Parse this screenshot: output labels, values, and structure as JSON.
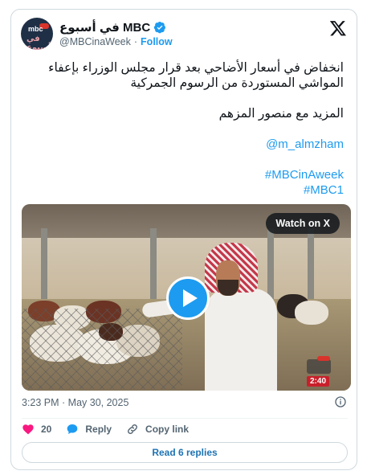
{
  "account": {
    "display_name": "في أسبوع MBC",
    "handle": "@MBCinaWeek",
    "separator": "·",
    "follow_label": "Follow",
    "avatar_logo_top": "mbc",
    "avatar_logo_bottom": "في أسبوع"
  },
  "tweet": {
    "lines": [
      "انخفاض في أسعار الأضاحي بعد قرار مجلس الوزراء بإعفاء",
      "المواشي المستوردة من الرسوم الجمركية",
      "المزيد مع منصور المزهم"
    ],
    "mention": "@m_almzham",
    "hashtags": [
      "#MBCinAweek",
      "#MBC1"
    ]
  },
  "media": {
    "watch_label": "Watch on X",
    "duration": "2:40",
    "watermark_logo": "mbc"
  },
  "footer": {
    "timestamp": "3:23 PM · May 30, 2025",
    "like_count": "20",
    "reply_label": "Reply",
    "copy_link_label": "Copy link",
    "read_replies_label": "Read 6 replies"
  },
  "colors": {
    "accent": "#1d9bf0",
    "like": "#f91880",
    "text": "#0f1419",
    "muted": "#536471"
  }
}
